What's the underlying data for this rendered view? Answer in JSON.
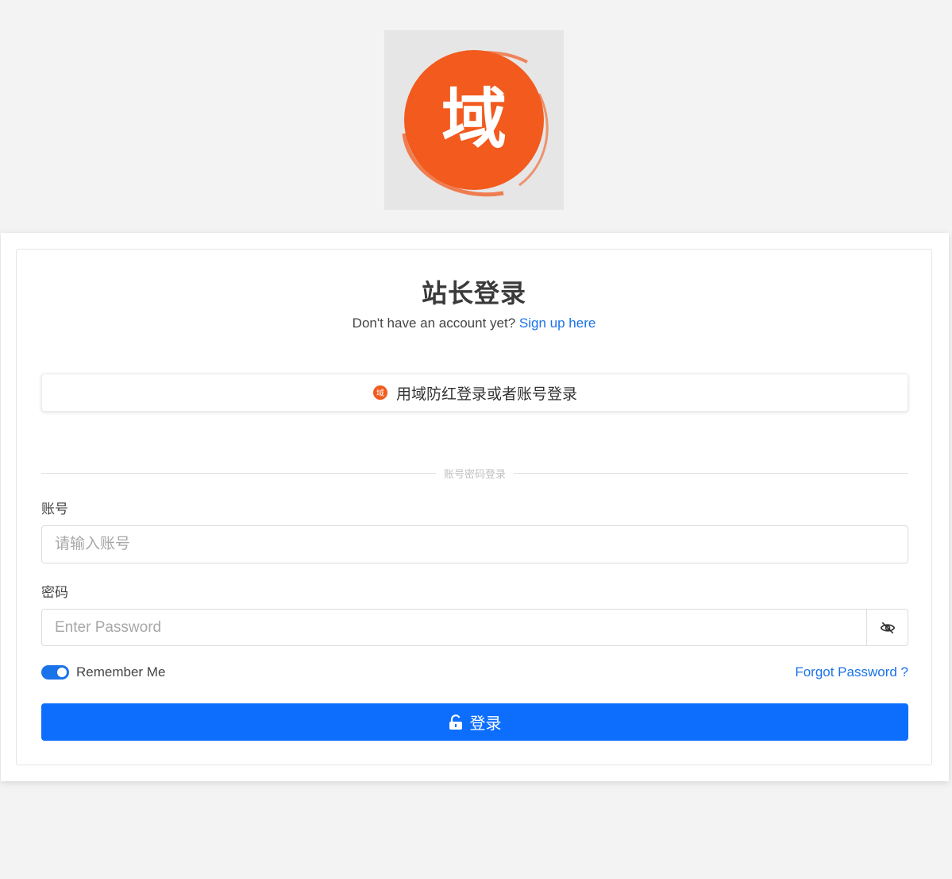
{
  "logo": {
    "glyph": "域",
    "icon": "domain-seal-logo",
    "colors": {
      "seal": "#f25a1e",
      "glyph": "#ffffff",
      "background": "#e6e6e6"
    }
  },
  "login": {
    "title": "站长登录",
    "signup_prompt": "Don't have an account yet?",
    "signup_link": "Sign up here",
    "sso_button_label": "用域防红登录或者账号登录",
    "divider_label": "账号密码登录",
    "account_label": "账号",
    "account_placeholder": "请输入账号",
    "password_label": "密码",
    "password_placeholder": "Enter Password",
    "password_toggle_icon": "eye-off-icon",
    "remember_me_label": "Remember Me",
    "remember_me_checked": true,
    "forgot_password_label": "Forgot Password ?",
    "submit_label": "登录",
    "submit_icon": "unlock-icon"
  },
  "colors": {
    "primary": "#0d6efd",
    "link": "#1a73e8",
    "page_background": "#f3f3f3"
  }
}
